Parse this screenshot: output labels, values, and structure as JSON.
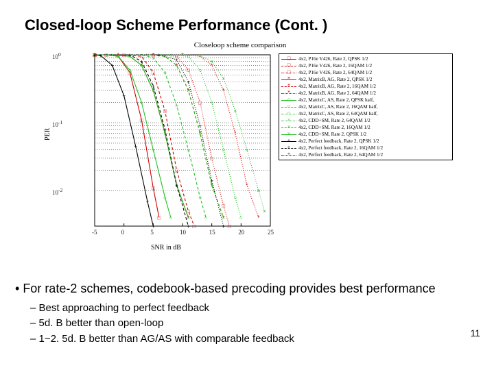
{
  "title": "Closed-loop Scheme Performance (Cont. )",
  "chart_data": {
    "type": "line",
    "title": "Closeloop scheme comparison",
    "xlabel": "SNR in dB",
    "ylabel": "PER",
    "xlim": [
      -5,
      25
    ],
    "ylim": [
      0.003,
      1
    ],
    "yscale": "log",
    "xticks": [
      -5,
      0,
      5,
      10,
      15,
      20,
      25
    ],
    "yticks_labels": [
      "10^0",
      "10^-1",
      "10^-2"
    ],
    "yticks": [
      1,
      0.1,
      0.01
    ],
    "legend_position": "right",
    "series": [
      {
        "name": "4x2, P16e V426, Rate 2, QPSK 1/2",
        "color": "#d00000",
        "marker": "□",
        "dash": "none",
        "x": [
          -5,
          -3,
          -1,
          1,
          3,
          5,
          6
        ],
        "y": [
          1,
          1,
          0.95,
          0.55,
          0.11,
          0.011,
          0.004
        ]
      },
      {
        "name": "4x2, P16e V426, Rate 2, 16QAM 1/2",
        "color": "#d00000",
        "marker": "□",
        "dash": "4 3",
        "x": [
          -5,
          0,
          3,
          5,
          7,
          9,
          11,
          12
        ],
        "y": [
          1,
          1,
          0.95,
          0.55,
          0.15,
          0.02,
          0.005,
          0.003
        ]
      },
      {
        "name": "4x2, P16e V426, Rate 2, 64QAM 1/2",
        "color": "#d00000",
        "marker": "□",
        "dash": "1 2",
        "x": [
          -5,
          5,
          9,
          11,
          13,
          15,
          17,
          18
        ],
        "y": [
          1,
          1,
          0.95,
          0.6,
          0.2,
          0.03,
          0.006,
          0.003
        ]
      },
      {
        "name": "4x2, MatrixB, AG, Rate 2, QPSK 1/2",
        "color": "#d00000",
        "marker": "*",
        "dash": "none",
        "x": [
          -5,
          -1,
          1,
          3,
          5,
          7,
          9,
          11
        ],
        "y": [
          1,
          1,
          0.95,
          0.7,
          0.3,
          0.07,
          0.012,
          0.004
        ]
      },
      {
        "name": "4x2, MatrixB, AG, Rate 2, 16QAM 1/2",
        "color": "#d00000",
        "marker": "*",
        "dash": "4 3",
        "x": [
          -5,
          5,
          7,
          9,
          11,
          13,
          15,
          17
        ],
        "y": [
          1,
          1,
          0.95,
          0.7,
          0.3,
          0.07,
          0.012,
          0.004
        ]
      },
      {
        "name": "4x2, MatrixB, AG, Rate 2, 64QAM 1/2",
        "color": "#d00000",
        "marker": "*",
        "dash": "1 2",
        "x": [
          -5,
          10,
          13,
          15,
          17,
          19,
          21,
          23
        ],
        "y": [
          1,
          1,
          0.95,
          0.7,
          0.3,
          0.07,
          0.012,
          0.004
        ]
      },
      {
        "name": "4x2, MatrixC, AS, Rate 2, QPSK half,",
        "color": "#20c020",
        "marker": "○",
        "dash": "none",
        "x": [
          -5,
          -3,
          -1,
          1,
          3,
          5,
          7,
          8
        ],
        "y": [
          1,
          1,
          0.95,
          0.6,
          0.2,
          0.04,
          0.008,
          0.004
        ]
      },
      {
        "name": "4x2, MatrixC, AS, Rate 2, 16QAM half,",
        "color": "#20c020",
        "marker": "○",
        "dash": "4 3",
        "x": [
          -5,
          3,
          5,
          7,
          9,
          11,
          13,
          14
        ],
        "y": [
          1,
          1,
          0.9,
          0.55,
          0.18,
          0.04,
          0.008,
          0.004
        ]
      },
      {
        "name": "4x2, MatrixC, AS, Rate 2, 64QAM half,",
        "color": "#20c020",
        "marker": "○",
        "dash": "1 2",
        "x": [
          -5,
          8,
          11,
          13,
          15,
          17,
          19,
          20
        ],
        "y": [
          1,
          1,
          0.95,
          0.6,
          0.2,
          0.04,
          0.008,
          0.004
        ]
      },
      {
        "name": "4x2, CDD+SM, Rate 2, 64QAM 1/2",
        "color": "#20c020",
        "marker": "×",
        "dash": "1 2",
        "x": [
          -5,
          10,
          13,
          15,
          17,
          19,
          21,
          23,
          24
        ],
        "y": [
          1,
          1,
          0.98,
          0.8,
          0.45,
          0.15,
          0.04,
          0.01,
          0.005
        ]
      },
      {
        "name": "4x2, CDD+SM, Rate 2, 16QAM 1/2",
        "color": "#20c020",
        "marker": "×",
        "dash": "4 3",
        "x": [
          -5,
          4,
          7,
          9,
          11,
          13,
          15,
          17
        ],
        "y": [
          1,
          1,
          0.95,
          0.7,
          0.3,
          0.07,
          0.012,
          0.004
        ]
      },
      {
        "name": "4x2, CDD+SM, Rate 2, QPSK 1/2",
        "color": "#20c020",
        "marker": "×",
        "dash": "none",
        "x": [
          -5,
          -2,
          1,
          3,
          5,
          7,
          9,
          11
        ],
        "y": [
          1,
          1,
          0.95,
          0.7,
          0.3,
          0.07,
          0.012,
          0.004
        ]
      },
      {
        "name": "4x2, Perfect feedback, Rate 2, QPSK 1/2",
        "color": "#000000",
        "marker": "+",
        "dash": "none",
        "x": [
          -5,
          -4,
          -2,
          0,
          2,
          4,
          5
        ],
        "y": [
          1,
          0.98,
          0.7,
          0.25,
          0.045,
          0.007,
          0.003
        ]
      },
      {
        "name": "4x2, Perfect feedback, Rate 2, 16QAM 1/2",
        "color": "#000000",
        "marker": "+",
        "dash": "4 3",
        "x": [
          -5,
          1,
          3,
          5,
          7,
          9,
          11
        ],
        "y": [
          1,
          1,
          0.8,
          0.35,
          0.08,
          0.012,
          0.003
        ]
      },
      {
        "name": "4x2, Perfect feedback, Rate 2, 64QAM 1/2",
        "color": "#000000",
        "marker": "+",
        "dash": "1 2",
        "x": [
          -5,
          6,
          9,
          11,
          13,
          15,
          17
        ],
        "y": [
          1,
          1,
          0.85,
          0.4,
          0.09,
          0.014,
          0.003
        ]
      }
    ]
  },
  "bullets": {
    "main": "For rate-2 schemes, codebook-based precoding provides best performance",
    "subs": [
      "Best approaching to perfect feedback",
      "5d. B better than open-loop",
      "1~2. 5d. B better than AG/AS with comparable feedback"
    ]
  },
  "page_number": "11"
}
